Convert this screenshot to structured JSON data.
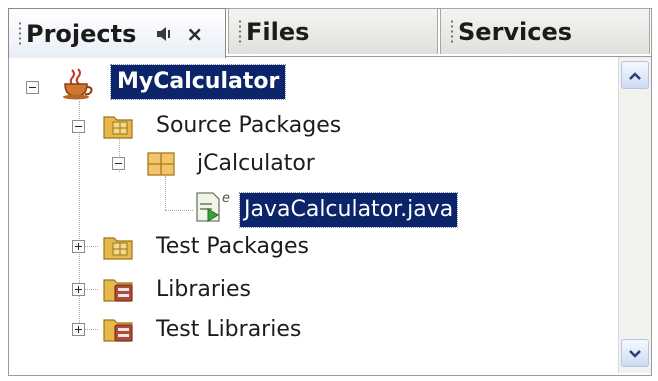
{
  "tabs": {
    "projects": "Projects",
    "files": "Files",
    "services": "Services",
    "close_symbol": "×"
  },
  "tree": {
    "root": "MyCalculator",
    "source_packages": "Source Packages",
    "package": "jCalculator",
    "file": "JavaCalculator.java",
    "test_packages": "Test Packages",
    "libraries": "Libraries",
    "test_libraries": "Test Libraries"
  },
  "icons": {
    "project": "coffee-cup-icon",
    "folder": "package-folder-icon",
    "package": "package-icon",
    "java_file": "java-class-file-icon",
    "library_folder": "library-folder-icon",
    "speaker": "minimize-speaker-icon",
    "scroll_up": "chevron-up-icon",
    "scroll_down": "chevron-down-icon"
  },
  "colors": {
    "selection": "#0b246a",
    "selection_text": "#ffffff",
    "folder": "#e8b94a",
    "scroll_button": "#cddbf3"
  }
}
